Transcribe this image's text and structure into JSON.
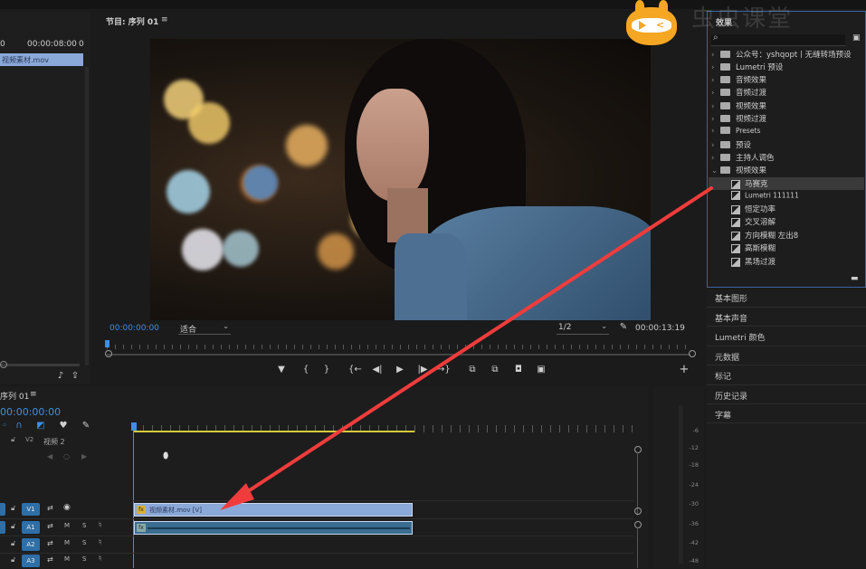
{
  "source_panel": {
    "timecode_a": "0",
    "timecode_b": "00:00:08:00",
    "timecode_c": "0",
    "clip_label": "视频素材.mov"
  },
  "program_monitor": {
    "title": "节目: 序列 01",
    "menu_glyph": "≡",
    "current_time": "00:00:00:00",
    "fit_option": "适合",
    "resolution": "1/2",
    "duration": "00:00:13:19",
    "wrench_glyph": "🔧",
    "add_glyph": "+"
  },
  "transport": {
    "marker": "▼",
    "in": "{",
    "out": "}",
    "go_in": "{←",
    "step_back": "◀|",
    "play": "▶",
    "step_fwd": "|▶",
    "go_out": "→}",
    "lift": "⧉",
    "extract": "⧉",
    "export_frame": "◘",
    "compare": "▣"
  },
  "timeline": {
    "title": "序列 01",
    "menu_glyph": "≡",
    "current_time": "00:00:00:00",
    "tracks": [
      {
        "name": "V2",
        "label": "视频 2"
      },
      {
        "name": "V1"
      },
      {
        "name": "A1",
        "m": "M",
        "s": "S"
      },
      {
        "name": "A2",
        "m": "M",
        "s": "S"
      },
      {
        "name": "A3",
        "m": "M",
        "s": "S"
      }
    ],
    "clip_label": "视频素材.mov [V]",
    "fx_badge": "fx"
  },
  "audio_meter": {
    "labels": [
      "-6",
      "-12",
      "-18",
      "-24",
      "-30",
      "-36",
      "-42",
      "-48"
    ]
  },
  "effects_panel": {
    "title": "效果",
    "search_placeholder": "",
    "items": [
      {
        "label": "公众号：yshqopt丨无缝转场预设",
        "indent": 0,
        "type": "folder"
      },
      {
        "label": "Lumetri 预设",
        "indent": 0,
        "type": "folder"
      },
      {
        "label": "音频效果",
        "indent": 0,
        "type": "folder"
      },
      {
        "label": "音频过渡",
        "indent": 0,
        "type": "folder"
      },
      {
        "label": "视频效果",
        "indent": 0,
        "type": "folder"
      },
      {
        "label": "视频过渡",
        "indent": 0,
        "type": "folder"
      },
      {
        "label": "Presets",
        "indent": 0,
        "type": "folder"
      },
      {
        "label": "预设",
        "indent": 0,
        "type": "folder"
      },
      {
        "label": "主持人调色",
        "indent": 0,
        "type": "folder"
      },
      {
        "label": "视频效果",
        "indent": 0,
        "type": "folder-open"
      },
      {
        "label": "马赛克",
        "indent": 1,
        "type": "effect",
        "selected": true
      },
      {
        "label": "Lumetri 111111",
        "indent": 1,
        "type": "effect"
      },
      {
        "label": "恒定功率",
        "indent": 1,
        "type": "effect"
      },
      {
        "label": "交叉溶解",
        "indent": 1,
        "type": "effect"
      },
      {
        "label": "方向模糊 左出8",
        "indent": 1,
        "type": "effect"
      },
      {
        "label": "高斯模糊",
        "indent": 1,
        "type": "effect"
      },
      {
        "label": "黑场过渡",
        "indent": 1,
        "type": "effect"
      }
    ]
  },
  "side_panels": [
    "基本图形",
    "基本声音",
    "Lumetri 颜色",
    "元数据",
    "标记",
    "历史记录",
    "字幕"
  ],
  "watermark": {
    "text": "虫虫课堂"
  },
  "colors": {
    "accent_blue": "#3f8ee6",
    "clip_blue": "#8aa8d8",
    "audio_clip": "#3a6d8f",
    "playhead_yellow": "#d7c93a",
    "arrow_red": "#f03c3c",
    "logo_orange": "#f5a623"
  }
}
